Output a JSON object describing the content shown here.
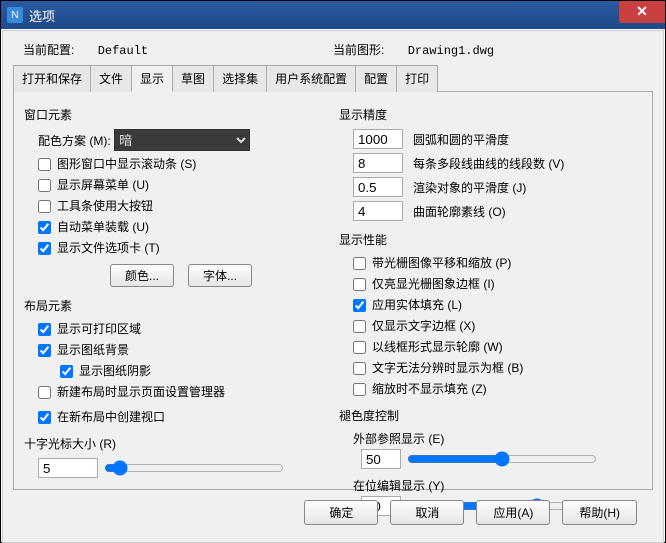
{
  "title": "选项",
  "top": {
    "config_label": "当前配置:",
    "config_value": "Default",
    "drawing_label": "当前图形:",
    "drawing_value": "Drawing1.dwg"
  },
  "tabs": {
    "open_save": "打开和保存",
    "file": "文件",
    "display": "显示",
    "sketch": "草图",
    "selection": "选择集",
    "user_system": "用户系统配置",
    "profile": "配置",
    "print": "打印"
  },
  "window_elements": {
    "title": "窗口元素",
    "color_scheme_label": "配色方案 (M):",
    "color_scheme_value": "暗",
    "scrollbars": "图形窗口中显示滚动条 (S)",
    "screen_menu": "显示屏幕菜单 (U)",
    "large_buttons": "工具条使用大按钮",
    "auto_menu_load": "自动菜单装载 (U)",
    "file_tabs": "显示文件选项卡 (T)",
    "btn_colors": "颜色...",
    "btn_fonts": "字体..."
  },
  "layout_elements": {
    "title": "布局元素",
    "print_area": "显示可打印区域",
    "paper_bg": "显示图纸背景",
    "paper_shadow": "显示图纸阴影",
    "page_setup_mgr": "新建布局时显示页面设置管理器",
    "create_viewport": "在新布局中创建视口"
  },
  "crosshair": {
    "title": "十字光标大小 (R)",
    "value": "5"
  },
  "precision": {
    "title": "显示精度",
    "arc_value": "1000",
    "arc_label": "圆弧和圆的平滑度",
    "poly_value": "8",
    "poly_label": "每条多段线曲线的线段数 (V)",
    "render_value": "0.5",
    "render_label": "渲染对象的平滑度 (J)",
    "surface_value": "4",
    "surface_label": "曲面轮廓素线 (O)"
  },
  "performance": {
    "title": "显示性能",
    "raster_pan": "带光栅图像平移和缩放 (P)",
    "highlight_frame": "仅亮显光栅图象边框 (I)",
    "solid_fill": "应用实体填充 (L)",
    "text_frame": "仅显示文字边框 (X)",
    "wireframe": "以线框形式显示轮廓 (W)",
    "text_bound": "文字无法分辨时显示为框 (B)",
    "no_zoom_fill": "缩放时不显示填充 (Z)"
  },
  "fade": {
    "title": "褪色度控制",
    "xref_label": "外部参照显示 (E)",
    "xref_value": "50",
    "inplace_label": "在位编辑显示 (Y)",
    "inplace_value": "70"
  },
  "footer": {
    "ok": "确定",
    "cancel": "取消",
    "apply": "应用(A)",
    "help": "帮助(H)"
  }
}
